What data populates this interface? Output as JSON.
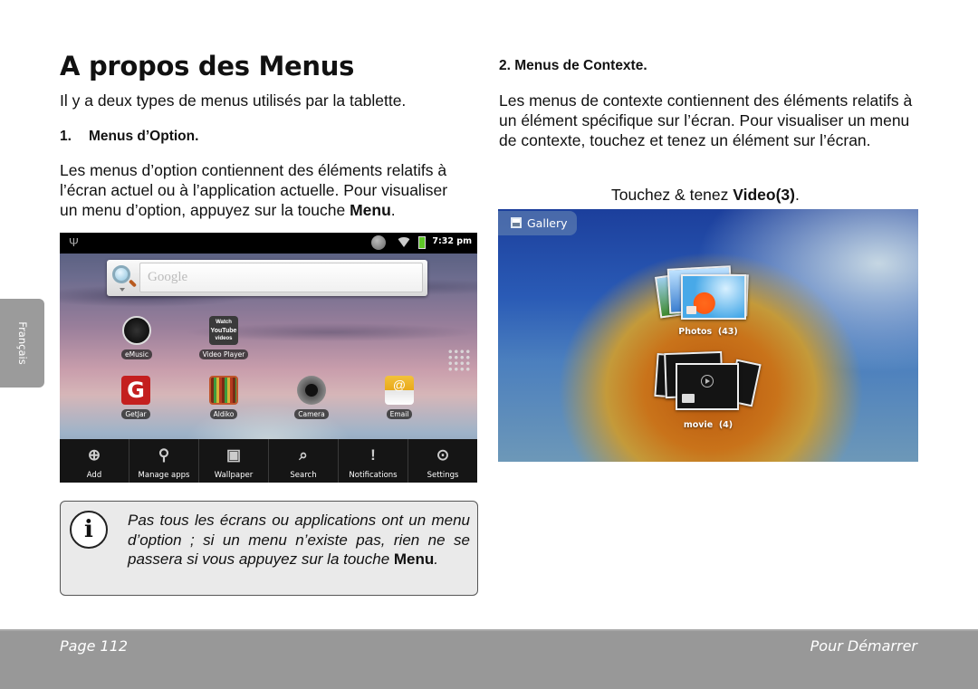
{
  "title": "A propos des Menus",
  "intro": "Il y a deux types de menus utilisés par la tablette.",
  "section1": {
    "number": "1.",
    "heading": "Menus d’Option.",
    "body": "Les menus d’option contiennent des éléments relatifs à l’écran actuel ou à l’application actuelle. Pour visualiser un menu d’option, appuyez sur la touche ",
    "body_bold": "Menu",
    "body_end": "."
  },
  "section2": {
    "heading": "2. Menus de Contexte.",
    "body": "Les menus de contexte contiennent des éléments relatifs à un élément spécifique sur l’écran. Pour visualiser un menu de contexte, touchez et tenez un élément sur l’écran.",
    "instruction": "Touchez & tenez ",
    "instruction_bold": "Video(3)",
    "instruction_end": "."
  },
  "side_tab": "Français",
  "home_screen": {
    "status_bar": {
      "time": "7:32 pm",
      "icons": [
        "usb-icon",
        "search-icon",
        "wifi-icon",
        "battery-icon"
      ]
    },
    "search_placeholder": "Google",
    "apps": [
      {
        "label": "eMusic",
        "icon": "emusic-icon"
      },
      {
        "label": "Video Player",
        "icon": "youtube-icon",
        "icon_text": [
          "Watch",
          "YouTube",
          "videos"
        ]
      },
      {
        "label": "GetJar",
        "icon": "getjar-icon",
        "icon_text": "G"
      },
      {
        "label": "Aldiko",
        "icon": "aldiko-icon"
      },
      {
        "label": "Camera",
        "icon": "camera-icon"
      },
      {
        "label": "Email",
        "icon": "email-icon",
        "icon_text": "@"
      }
    ],
    "options_menu": [
      {
        "label": "Add",
        "icon": "add-icon",
        "glyph": "⊕"
      },
      {
        "label": "Manage apps",
        "icon": "manage-apps-icon",
        "glyph": "⚲"
      },
      {
        "label": "Wallpaper",
        "icon": "wallpaper-icon",
        "glyph": "▣"
      },
      {
        "label": "Search",
        "icon": "search-icon",
        "glyph": "⌕"
      },
      {
        "label": "Notifications",
        "icon": "notifications-icon",
        "glyph": "!"
      },
      {
        "label": "Settings",
        "icon": "settings-icon",
        "glyph": "⊙"
      }
    ]
  },
  "note": {
    "icon": "info-icon",
    "icon_glyph": "i",
    "text": "Pas tous les écrans ou applications ont un menu d’option ; si un menu n’existe pas, rien ne se passera si vous appuyez sur la touche ",
    "text_bold": "Menu",
    "text_end": "."
  },
  "gallery_screen": {
    "title": "Gallery",
    "albums": [
      {
        "name": "Photos",
        "count": "(43)"
      },
      {
        "name": "movie",
        "count": "(4)"
      }
    ]
  },
  "footer": {
    "page": "Page 112",
    "section": "Pour Démarrer"
  }
}
